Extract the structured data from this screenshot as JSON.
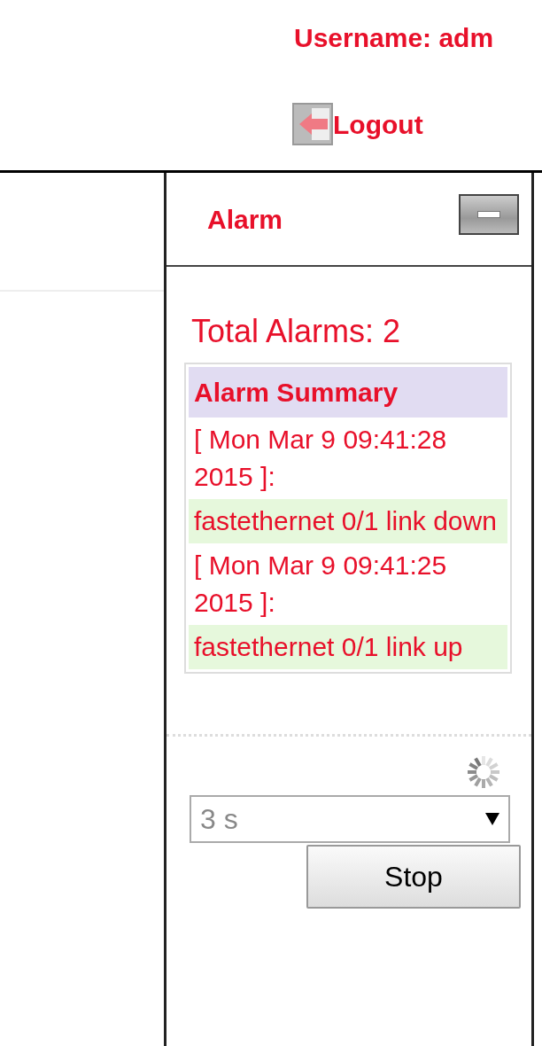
{
  "header": {
    "username": "Username: adm",
    "logout": "Logout"
  },
  "alarm_panel": {
    "title": "Alarm",
    "total": "Total Alarms: 2",
    "summary": {
      "title": "Alarm Summary",
      "entries": [
        {
          "time": "[ Mon Mar 9 09:41:28 2015 ]:",
          "message": "fastethernet 0/1 link down"
        },
        {
          "time": "[ Mon Mar 9 09:41:25 2015 ]:",
          "message": "fastethernet 0/1 link up"
        }
      ]
    },
    "interval": {
      "value": "3 s"
    },
    "stop": "Stop"
  }
}
